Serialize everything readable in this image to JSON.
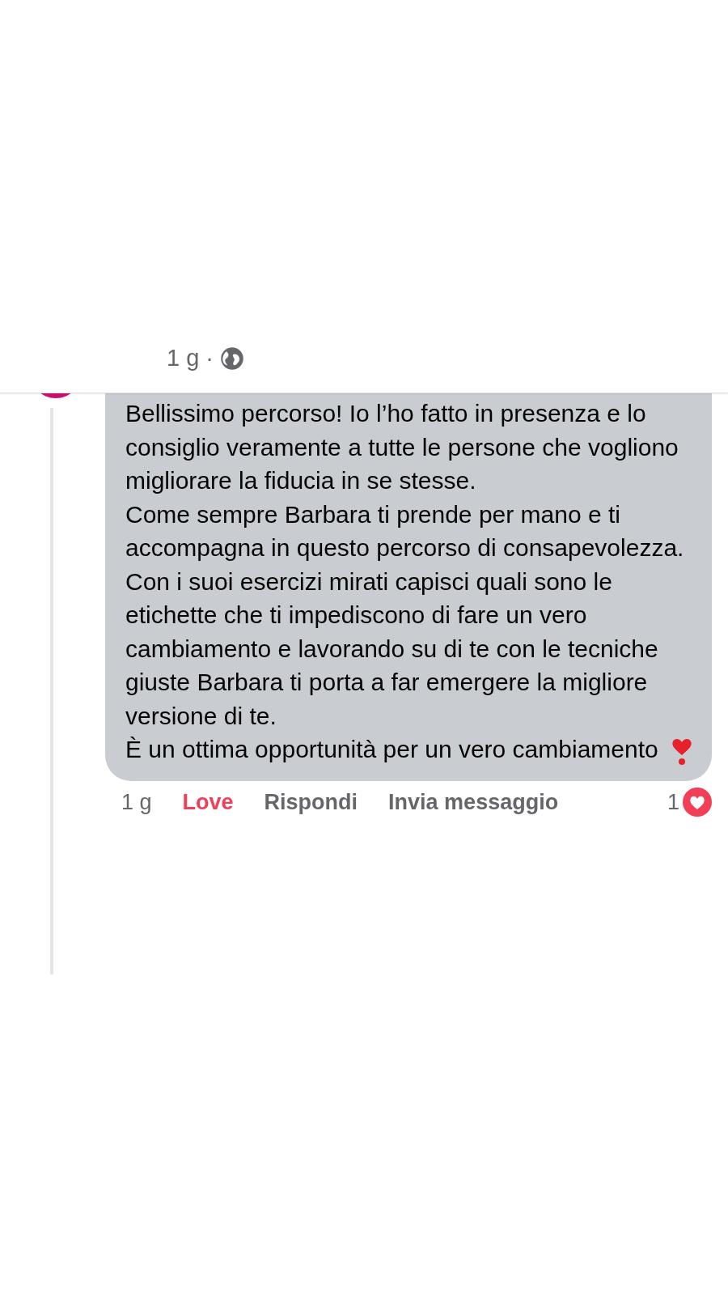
{
  "post_meta": {
    "time": "1 g",
    "separator": "·"
  },
  "comment": {
    "paragraphs": [
      "Bellissimo percorso! Io l’ho fatto in presenza e lo consiglio veramente a tutte le persone che vogliono migliorare la fiducia in se stesse.",
      "Come sempre Barbara ti prende per mano e ti accompagna in questo percorso di consapevolezza. Con i suoi esercizi mirati capisci quali sono le etichette che ti impediscono di fare un vero cambiamento e lavorando su di te con le tecniche giuste Barbara ti porta a far emergere la migliore versione di te.",
      "È un ottima opportunità per un vero cambiamento"
    ],
    "actions": [
      {
        "kind": "time",
        "label": "1 g"
      },
      {
        "kind": "reaction",
        "label": "Love"
      },
      {
        "kind": "link",
        "label": "Rispondi"
      },
      {
        "kind": "link",
        "label": "Invia messaggio"
      }
    ],
    "reaction_count": "1"
  }
}
